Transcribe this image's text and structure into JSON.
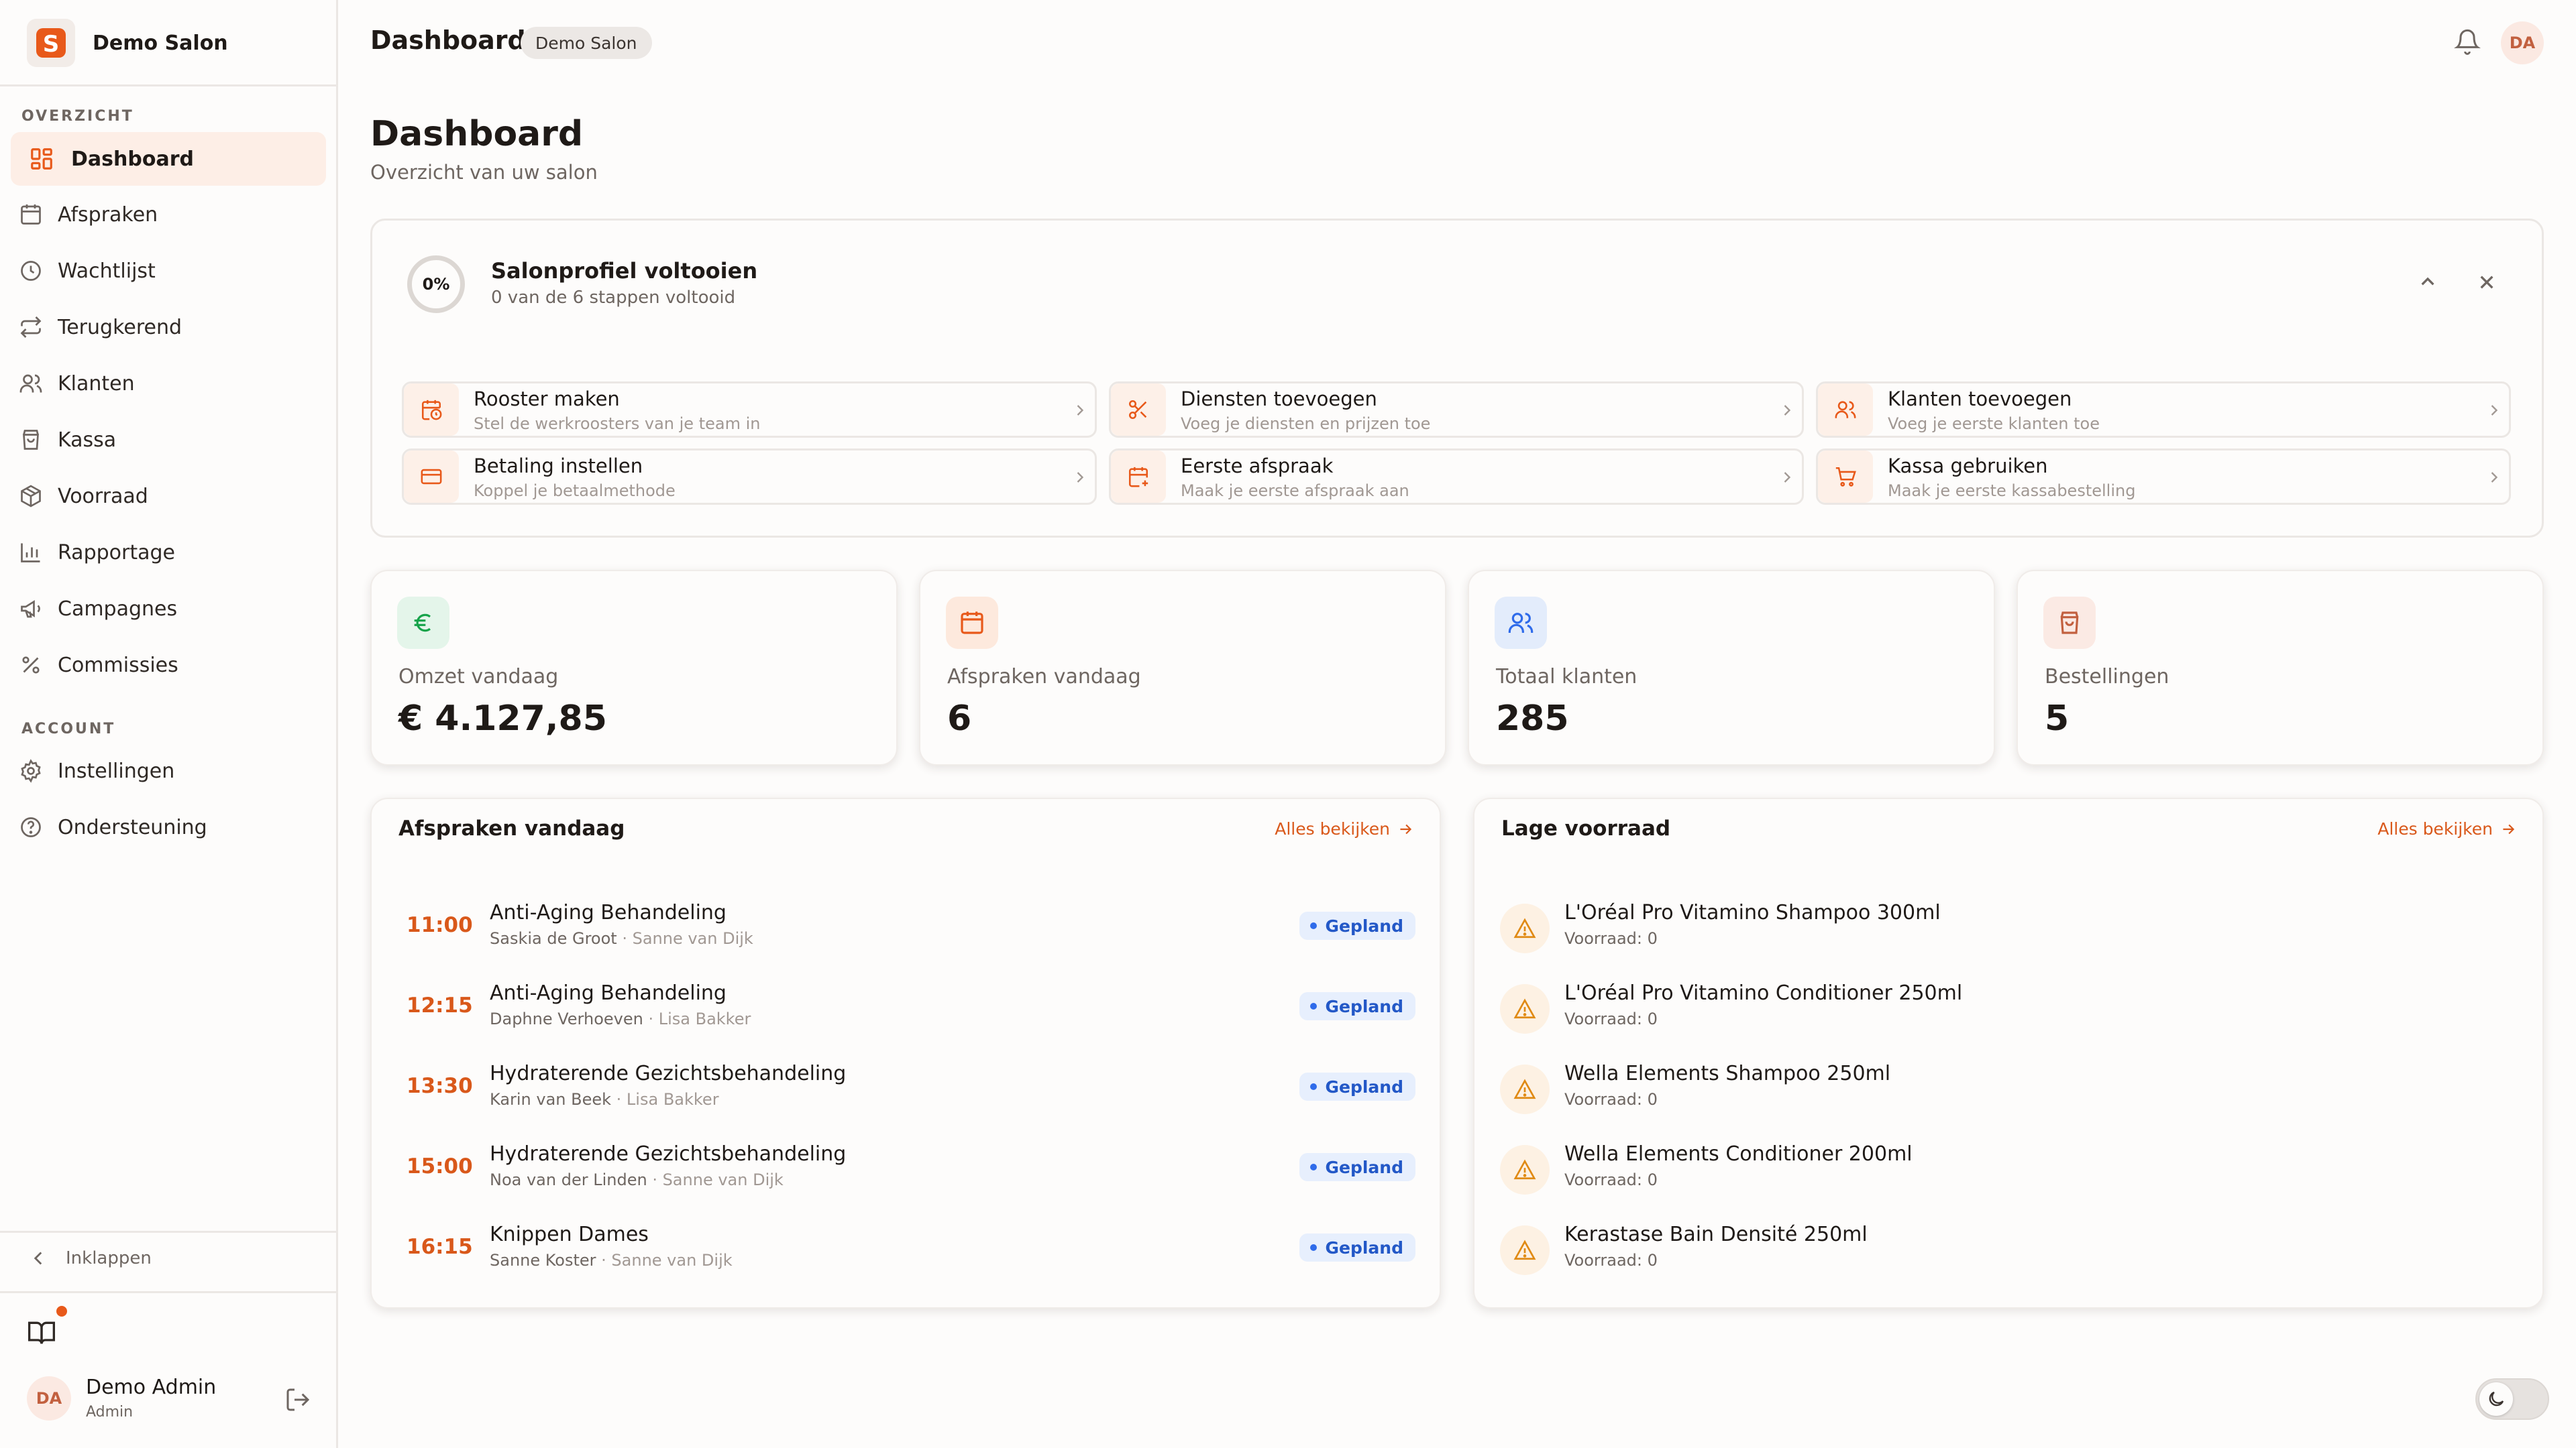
{
  "colors": {
    "accent": "#e8591a",
    "accent_text": "#d9581a",
    "status_blue": "#2358c7"
  },
  "sidebar": {
    "brand_name": "Demo Salon",
    "brand_logo_letter": "S",
    "sections": {
      "overview": "OVERZICHT",
      "account": "ACCOUNT"
    },
    "items": [
      {
        "label": "Dashboard",
        "icon": "dashboard-icon",
        "active": true
      },
      {
        "label": "Afspraken",
        "icon": "calendar-icon"
      },
      {
        "label": "Wachtlijst",
        "icon": "clock-icon"
      },
      {
        "label": "Terugkerend",
        "icon": "repeat-icon"
      },
      {
        "label": "Klanten",
        "icon": "users-icon"
      },
      {
        "label": "Kassa",
        "icon": "shopping-bag-icon"
      },
      {
        "label": "Voorraad",
        "icon": "package-icon"
      },
      {
        "label": "Rapportage",
        "icon": "bar-chart-icon"
      },
      {
        "label": "Campagnes",
        "icon": "megaphone-icon"
      },
      {
        "label": "Commissies",
        "icon": "percent-icon"
      },
      {
        "label": "Instellingen",
        "icon": "gear-icon"
      },
      {
        "label": "Ondersteuning",
        "icon": "help-circle-icon"
      }
    ],
    "collapse_label": "Inklappen",
    "user": {
      "initials": "DA",
      "name": "Demo Admin",
      "role": "Admin"
    }
  },
  "topbar": {
    "title": "Dashboard",
    "badge": "Demo Salon",
    "avatar_initials": "DA"
  },
  "page": {
    "title": "Dashboard",
    "subtitle": "Overzicht van uw salon"
  },
  "setup": {
    "progress_percent": 0,
    "progress_label": "0%",
    "title": "Salonprofiel voltooien",
    "subtitle": "0 van de 6 stappen voltooid",
    "steps": [
      {
        "title": "Rooster maken",
        "desc": "Stel de werkroosters van je team in",
        "icon": "calendar-clock-icon"
      },
      {
        "title": "Diensten toevoegen",
        "desc": "Voeg je diensten en prijzen toe",
        "icon": "scissors-icon"
      },
      {
        "title": "Klanten toevoegen",
        "desc": "Voeg je eerste klanten toe",
        "icon": "users-icon"
      },
      {
        "title": "Betaling instellen",
        "desc": "Koppel je betaalmethode",
        "icon": "credit-card-icon"
      },
      {
        "title": "Eerste afspraak",
        "desc": "Maak je eerste afspraak aan",
        "icon": "calendar-plus-icon"
      },
      {
        "title": "Kassa gebruiken",
        "desc": "Maak je eerste kassabestelling",
        "icon": "cart-icon"
      }
    ]
  },
  "stats": [
    {
      "label": "Omzet vandaag",
      "value": "€ 4.127,85",
      "icon": "euro-icon",
      "color": "#16a34a",
      "bg": "#e4f5ea"
    },
    {
      "label": "Afspraken vandaag",
      "value": "6",
      "icon": "calendar-icon",
      "color": "#e8591a",
      "bg": "#fde9dd"
    },
    {
      "label": "Totaal klanten",
      "value": "285",
      "icon": "users-icon",
      "color": "#2f6bea",
      "bg": "#e3ecfb"
    },
    {
      "label": "Bestellingen",
      "value": "5",
      "icon": "shopping-bag-icon",
      "color": "#c2603f",
      "bg": "#fbeae4"
    }
  ],
  "appointments": {
    "title": "Afspraken vandaag",
    "link": "Alles bekijken",
    "items": [
      {
        "time": "11:00",
        "service": "Anti-Aging Behandeling",
        "client": "Saskia de Groot",
        "staff": " · Sanne van Dijk",
        "status": "Gepland"
      },
      {
        "time": "12:15",
        "service": "Anti-Aging Behandeling",
        "client": "Daphne Verhoeven",
        "staff": " · Lisa Bakker",
        "status": "Gepland"
      },
      {
        "time": "13:30",
        "service": "Hydraterende Gezichtsbehandeling",
        "client": "Karin van Beek",
        "staff": " · Lisa Bakker",
        "status": "Gepland"
      },
      {
        "time": "15:00",
        "service": "Hydraterende Gezichtsbehandeling",
        "client": "Noa van der Linden",
        "staff": " · Sanne van Dijk",
        "status": "Gepland"
      },
      {
        "time": "16:15",
        "service": "Knippen Dames",
        "client": "Sanne Koster",
        "staff": " · Sanne van Dijk",
        "status": "Gepland"
      }
    ]
  },
  "low_stock": {
    "title": "Lage voorraad",
    "link": "Alles bekijken",
    "items": [
      {
        "name": "L'Oréal Pro Vitamino Shampoo 300ml",
        "qty": "Voorraad: 0"
      },
      {
        "name": "L'Oréal Pro Vitamino Conditioner 250ml",
        "qty": "Voorraad: 0"
      },
      {
        "name": "Wella Elements Shampoo 250ml",
        "qty": "Voorraad: 0"
      },
      {
        "name": "Wella Elements Conditioner 200ml",
        "qty": "Voorraad: 0"
      },
      {
        "name": "Kerastase Bain Densité 250ml",
        "qty": "Voorraad: 0"
      }
    ]
  }
}
